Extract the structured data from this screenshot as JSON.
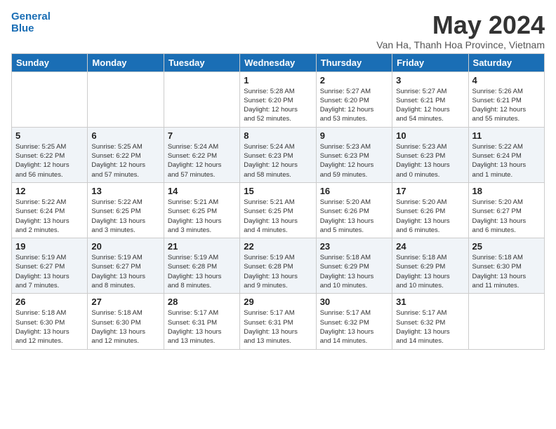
{
  "logo": {
    "line1": "General",
    "line2": "Blue"
  },
  "title": "May 2024",
  "location": "Van Ha, Thanh Hoa Province, Vietnam",
  "days_of_week": [
    "Sunday",
    "Monday",
    "Tuesday",
    "Wednesday",
    "Thursday",
    "Friday",
    "Saturday"
  ],
  "weeks": [
    [
      {
        "day": "",
        "info": ""
      },
      {
        "day": "",
        "info": ""
      },
      {
        "day": "",
        "info": ""
      },
      {
        "day": "1",
        "info": "Sunrise: 5:28 AM\nSunset: 6:20 PM\nDaylight: 12 hours\nand 52 minutes."
      },
      {
        "day": "2",
        "info": "Sunrise: 5:27 AM\nSunset: 6:20 PM\nDaylight: 12 hours\nand 53 minutes."
      },
      {
        "day": "3",
        "info": "Sunrise: 5:27 AM\nSunset: 6:21 PM\nDaylight: 12 hours\nand 54 minutes."
      },
      {
        "day": "4",
        "info": "Sunrise: 5:26 AM\nSunset: 6:21 PM\nDaylight: 12 hours\nand 55 minutes."
      }
    ],
    [
      {
        "day": "5",
        "info": "Sunrise: 5:25 AM\nSunset: 6:22 PM\nDaylight: 12 hours\nand 56 minutes."
      },
      {
        "day": "6",
        "info": "Sunrise: 5:25 AM\nSunset: 6:22 PM\nDaylight: 12 hours\nand 57 minutes."
      },
      {
        "day": "7",
        "info": "Sunrise: 5:24 AM\nSunset: 6:22 PM\nDaylight: 12 hours\nand 57 minutes."
      },
      {
        "day": "8",
        "info": "Sunrise: 5:24 AM\nSunset: 6:23 PM\nDaylight: 12 hours\nand 58 minutes."
      },
      {
        "day": "9",
        "info": "Sunrise: 5:23 AM\nSunset: 6:23 PM\nDaylight: 12 hours\nand 59 minutes."
      },
      {
        "day": "10",
        "info": "Sunrise: 5:23 AM\nSunset: 6:23 PM\nDaylight: 13 hours\nand 0 minutes."
      },
      {
        "day": "11",
        "info": "Sunrise: 5:22 AM\nSunset: 6:24 PM\nDaylight: 13 hours\nand 1 minute."
      }
    ],
    [
      {
        "day": "12",
        "info": "Sunrise: 5:22 AM\nSunset: 6:24 PM\nDaylight: 13 hours\nand 2 minutes."
      },
      {
        "day": "13",
        "info": "Sunrise: 5:22 AM\nSunset: 6:25 PM\nDaylight: 13 hours\nand 3 minutes."
      },
      {
        "day": "14",
        "info": "Sunrise: 5:21 AM\nSunset: 6:25 PM\nDaylight: 13 hours\nand 3 minutes."
      },
      {
        "day": "15",
        "info": "Sunrise: 5:21 AM\nSunset: 6:25 PM\nDaylight: 13 hours\nand 4 minutes."
      },
      {
        "day": "16",
        "info": "Sunrise: 5:20 AM\nSunset: 6:26 PM\nDaylight: 13 hours\nand 5 minutes."
      },
      {
        "day": "17",
        "info": "Sunrise: 5:20 AM\nSunset: 6:26 PM\nDaylight: 13 hours\nand 6 minutes."
      },
      {
        "day": "18",
        "info": "Sunrise: 5:20 AM\nSunset: 6:27 PM\nDaylight: 13 hours\nand 6 minutes."
      }
    ],
    [
      {
        "day": "19",
        "info": "Sunrise: 5:19 AM\nSunset: 6:27 PM\nDaylight: 13 hours\nand 7 minutes."
      },
      {
        "day": "20",
        "info": "Sunrise: 5:19 AM\nSunset: 6:27 PM\nDaylight: 13 hours\nand 8 minutes."
      },
      {
        "day": "21",
        "info": "Sunrise: 5:19 AM\nSunset: 6:28 PM\nDaylight: 13 hours\nand 8 minutes."
      },
      {
        "day": "22",
        "info": "Sunrise: 5:19 AM\nSunset: 6:28 PM\nDaylight: 13 hours\nand 9 minutes."
      },
      {
        "day": "23",
        "info": "Sunrise: 5:18 AM\nSunset: 6:29 PM\nDaylight: 13 hours\nand 10 minutes."
      },
      {
        "day": "24",
        "info": "Sunrise: 5:18 AM\nSunset: 6:29 PM\nDaylight: 13 hours\nand 10 minutes."
      },
      {
        "day": "25",
        "info": "Sunrise: 5:18 AM\nSunset: 6:30 PM\nDaylight: 13 hours\nand 11 minutes."
      }
    ],
    [
      {
        "day": "26",
        "info": "Sunrise: 5:18 AM\nSunset: 6:30 PM\nDaylight: 13 hours\nand 12 minutes."
      },
      {
        "day": "27",
        "info": "Sunrise: 5:18 AM\nSunset: 6:30 PM\nDaylight: 13 hours\nand 12 minutes."
      },
      {
        "day": "28",
        "info": "Sunrise: 5:17 AM\nSunset: 6:31 PM\nDaylight: 13 hours\nand 13 minutes."
      },
      {
        "day": "29",
        "info": "Sunrise: 5:17 AM\nSunset: 6:31 PM\nDaylight: 13 hours\nand 13 minutes."
      },
      {
        "day": "30",
        "info": "Sunrise: 5:17 AM\nSunset: 6:32 PM\nDaylight: 13 hours\nand 14 minutes."
      },
      {
        "day": "31",
        "info": "Sunrise: 5:17 AM\nSunset: 6:32 PM\nDaylight: 13 hours\nand 14 minutes."
      },
      {
        "day": "",
        "info": ""
      }
    ]
  ]
}
